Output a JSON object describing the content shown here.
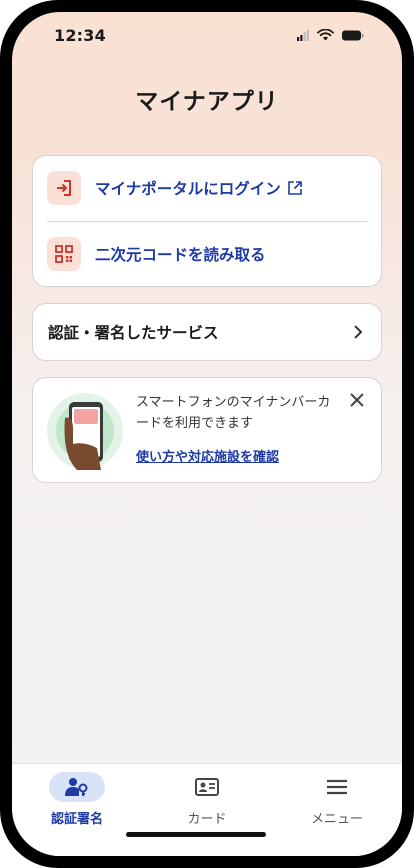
{
  "status_bar": {
    "time": "12:34"
  },
  "header": {
    "title": "マイナアプリ"
  },
  "menu": {
    "items": [
      {
        "label": "マイナポータルにログイン",
        "icon": "login-icon",
        "external": true
      },
      {
        "label": "二次元コードを読み取る",
        "icon": "qr-code-icon"
      }
    ]
  },
  "services": {
    "label": "認証・署名したサービス"
  },
  "info_card": {
    "message": "スマートフォンのマイナンバーカードを利用できます",
    "link": "使い方や対応施設を確認"
  },
  "tab_bar": {
    "tabs": [
      {
        "label": "認証署名",
        "icon": "person-key-icon",
        "active": true
      },
      {
        "label": "カード",
        "icon": "id-card-icon",
        "active": false
      },
      {
        "label": "メニュー",
        "icon": "hamburger-icon",
        "active": false
      }
    ]
  },
  "colors": {
    "accent": "#1d3aa6",
    "icon_red": "#d1332a",
    "icon_bg": "#fbe0d8",
    "active_tab_bg": "#d8e3f8"
  }
}
